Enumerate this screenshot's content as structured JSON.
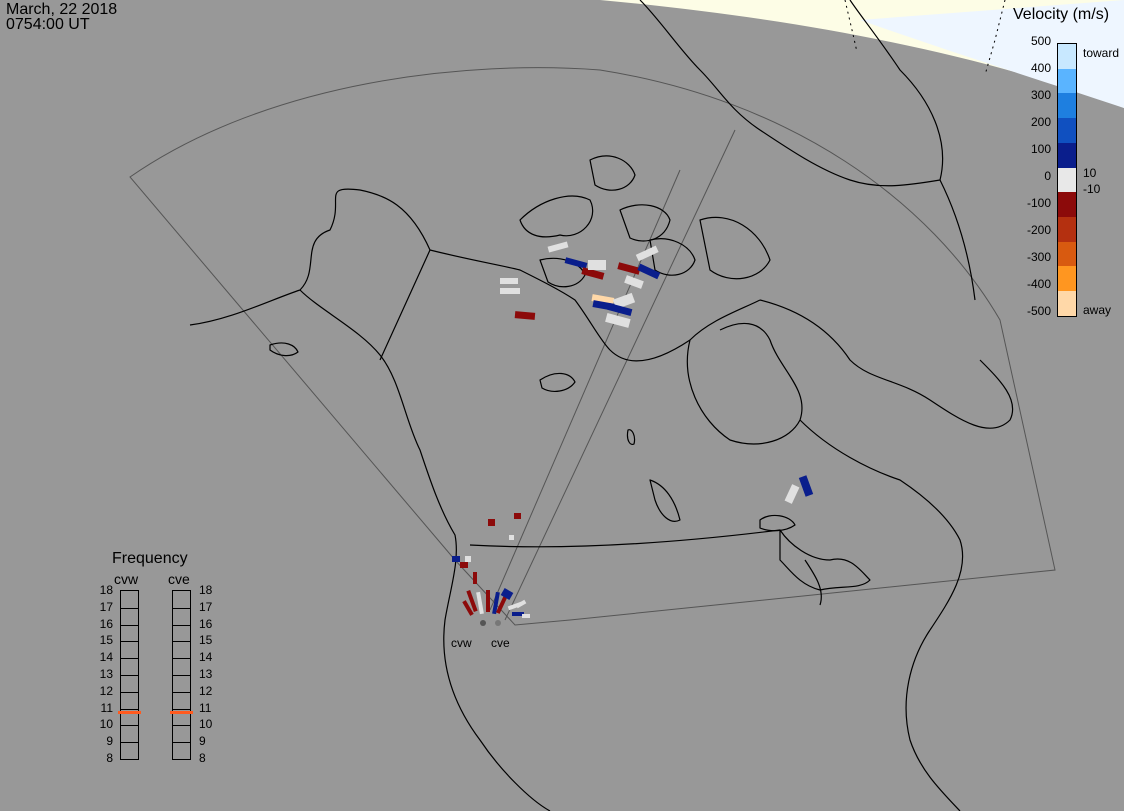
{
  "header": {
    "date": "March, 22 2018",
    "time": "0754:00 UT"
  },
  "velocity_scale": {
    "title": "Velocity (m/s)",
    "ticks": [
      "500",
      "400",
      "300",
      "200",
      "100",
      "0",
      "-100",
      "-200",
      "-300",
      "-400",
      "-500"
    ],
    "inner_labels": [
      "10",
      "-10"
    ],
    "toward_label": "toward",
    "away_label": "away",
    "colors": [
      "#c8e8ff",
      "#5ab4ff",
      "#1e7fe0",
      "#1050c0",
      "#0a1e8c",
      "#e8e8e8",
      "#8c0a0a",
      "#b43010",
      "#d85a10",
      "#ff9620",
      "#ffd8a8"
    ]
  },
  "frequency_scale": {
    "title": "Frequency",
    "columns": [
      "cvw",
      "cve"
    ],
    "ticks": [
      "18",
      "17",
      "16",
      "15",
      "14",
      "13",
      "12",
      "11",
      "10",
      "9",
      "8"
    ],
    "current": {
      "cvw": 10.8,
      "cve": 10.8
    },
    "marker_color": "#ff5a1e"
  },
  "sites": [
    {
      "name": "cvw"
    },
    {
      "name": "cve"
    }
  ],
  "colors": {
    "background": "#989898",
    "daylight": "#fdfde6",
    "twilight": "#eef6ff",
    "coast": "#000000",
    "fov": "#555555"
  }
}
